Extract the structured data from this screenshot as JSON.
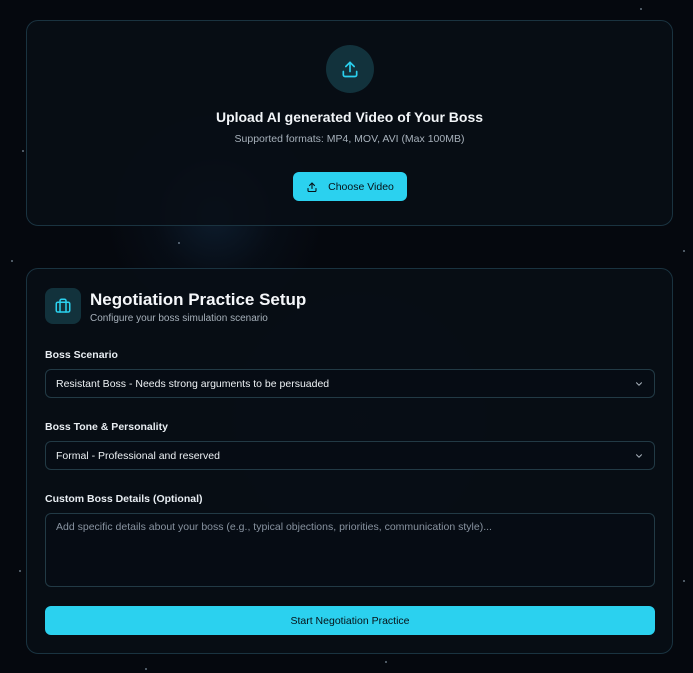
{
  "upload": {
    "icon": "upload-icon",
    "title": "Upload AI generated Video of Your Boss",
    "subtitle": "Supported formats: MP4, MOV, AVI (Max 100MB)",
    "button_label": "Choose Video"
  },
  "setup": {
    "icon": "briefcase-icon",
    "title": "Negotiation Practice Setup",
    "subtitle": "Configure your boss simulation scenario",
    "scenario_label": "Boss Scenario",
    "scenario_value": "Resistant Boss - Needs strong arguments to be persuaded",
    "tone_label": "Boss Tone & Personality",
    "tone_value": "Formal - Professional and reserved",
    "details_label": "Custom Boss Details (Optional)",
    "details_placeholder": "Add specific details about your boss (e.g., typical objections, priorities, communication style)...",
    "start_button_label": "Start Negotiation Practice"
  },
  "colors": {
    "accent": "#2bd1ef",
    "background": "#05080e",
    "card_border": "#1a3340"
  }
}
